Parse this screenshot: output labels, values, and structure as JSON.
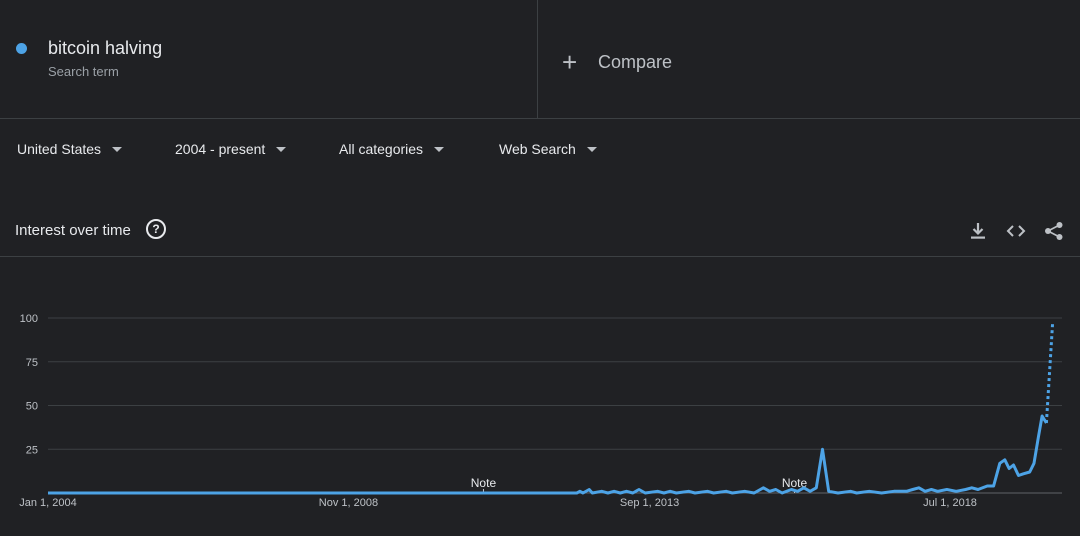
{
  "search_term": {
    "name": "bitcoin halving",
    "subtitle": "Search term",
    "color": "#4da3e6"
  },
  "compare": {
    "icon": "plus-icon",
    "label": "Compare"
  },
  "filters": [
    {
      "label": "United States",
      "icon": "caret-down-icon"
    },
    {
      "label": "2004 - present",
      "icon": "caret-down-icon"
    },
    {
      "label": "All categories",
      "icon": "caret-down-icon"
    },
    {
      "label": "Web Search",
      "icon": "caret-down-icon"
    }
  ],
  "panel": {
    "title": "Interest over time",
    "help_icon": "help-circle-icon",
    "tools": [
      "download-icon",
      "embed-code-icon",
      "share-icon"
    ]
  },
  "chart_data": {
    "type": "line",
    "ylim": [
      0,
      100
    ],
    "y_ticks": [
      25,
      50,
      75,
      100
    ],
    "x_ticks": [
      "Jan 1, 2004",
      "Nov 1, 2008",
      "Sep 1, 2013",
      "Jul 1, 2018"
    ],
    "x_tick_positions": [
      2004.0,
      2008.83,
      2013.67,
      2018.5
    ],
    "xlim": [
      2004.0,
      2020.3
    ],
    "notes": [
      {
        "x": 2011.0,
        "label": "Note"
      },
      {
        "x": 2016.0,
        "label": "Note"
      }
    ],
    "series": [
      {
        "color": "#4da3e6",
        "points": [
          [
            2004.0,
            0
          ],
          [
            2012.5,
            0
          ],
          [
            2012.55,
            1
          ],
          [
            2012.6,
            0
          ],
          [
            2012.7,
            2
          ],
          [
            2012.75,
            0
          ],
          [
            2012.9,
            1
          ],
          [
            2013.0,
            0
          ],
          [
            2013.1,
            1
          ],
          [
            2013.2,
            0
          ],
          [
            2013.3,
            1
          ],
          [
            2013.4,
            0
          ],
          [
            2013.5,
            2
          ],
          [
            2013.6,
            0
          ],
          [
            2013.8,
            1
          ],
          [
            2013.9,
            0
          ],
          [
            2014.0,
            1
          ],
          [
            2014.1,
            0
          ],
          [
            2014.3,
            1
          ],
          [
            2014.4,
            0
          ],
          [
            2014.6,
            1
          ],
          [
            2014.7,
            0
          ],
          [
            2014.9,
            1
          ],
          [
            2015.0,
            0
          ],
          [
            2015.2,
            1
          ],
          [
            2015.35,
            0
          ],
          [
            2015.5,
            3
          ],
          [
            2015.6,
            1
          ],
          [
            2015.7,
            2
          ],
          [
            2015.8,
            0
          ],
          [
            2015.95,
            2
          ],
          [
            2016.05,
            1
          ],
          [
            2016.15,
            3
          ],
          [
            2016.25,
            1
          ],
          [
            2016.35,
            3
          ],
          [
            2016.45,
            25
          ],
          [
            2016.55,
            1
          ],
          [
            2016.7,
            0
          ],
          [
            2016.9,
            1
          ],
          [
            2017.0,
            0
          ],
          [
            2017.2,
            1
          ],
          [
            2017.4,
            0
          ],
          [
            2017.6,
            1
          ],
          [
            2017.8,
            1
          ],
          [
            2017.9,
            2
          ],
          [
            2018.0,
            3
          ],
          [
            2018.1,
            1
          ],
          [
            2018.2,
            2
          ],
          [
            2018.3,
            1
          ],
          [
            2018.45,
            2
          ],
          [
            2018.6,
            1
          ],
          [
            2018.75,
            2
          ],
          [
            2018.85,
            3
          ],
          [
            2018.95,
            2
          ],
          [
            2019.1,
            4
          ],
          [
            2019.2,
            4
          ],
          [
            2019.3,
            17
          ],
          [
            2019.38,
            19
          ],
          [
            2019.45,
            14
          ],
          [
            2019.52,
            16
          ],
          [
            2019.6,
            10
          ],
          [
            2019.68,
            11
          ],
          [
            2019.78,
            12
          ],
          [
            2019.85,
            17
          ],
          [
            2019.92,
            32
          ],
          [
            2019.98,
            44
          ],
          [
            2020.05,
            40
          ]
        ],
        "partial_points": [
          [
            2020.05,
            40
          ],
          [
            2020.15,
            98
          ]
        ]
      }
    ]
  }
}
